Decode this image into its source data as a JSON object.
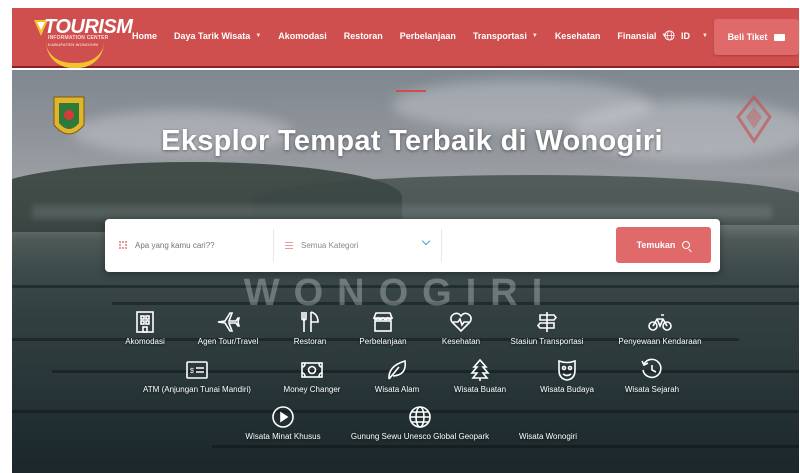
{
  "navbar": {
    "logo": {
      "title": "TOURISM",
      "subtitle": "INFORMATION CENTER",
      "tagline": "KABUPATEN WONOGIRI"
    },
    "menu": [
      {
        "label": "Home",
        "dropdown": false
      },
      {
        "label": "Daya Tarik Wisata",
        "dropdown": true
      },
      {
        "label": "Akomodasi",
        "dropdown": false
      },
      {
        "label": "Restoran",
        "dropdown": false
      },
      {
        "label": "Perbelanjaan",
        "dropdown": false
      },
      {
        "label": "Transportasi",
        "dropdown": true
      },
      {
        "label": "Kesehatan",
        "dropdown": false
      },
      {
        "label": "Finansial",
        "dropdown": true
      }
    ],
    "language": "ID",
    "ticket_button": "Beli Tiket",
    "colors": {
      "navbar": "#cf4f4f",
      "button": "#e06a6a"
    }
  },
  "hero": {
    "title": "Eksplor Tempat Terbaik di Wonogiri",
    "watermark": "WONOGIRI"
  },
  "search": {
    "placeholder": "Apa yang kamu cari??",
    "category_value": "Semua Kategori",
    "button_label": "Temukan"
  },
  "categories": {
    "row1": [
      {
        "label": "Akomodasi",
        "icon": "building-icon"
      },
      {
        "label": "Agen Tour/Travel",
        "icon": "airplane-icon"
      },
      {
        "label": "Restoran",
        "icon": "utensils-icon"
      },
      {
        "label": "Perbelanjaan",
        "icon": "store-icon"
      },
      {
        "label": "Kesehatan",
        "icon": "heart-pulse-icon"
      },
      {
        "label": "Stasiun Transportasi",
        "icon": "signpost-icon"
      },
      {
        "label": "Penyewaan Kendaraan",
        "icon": "bicycle-icon"
      }
    ],
    "row2": [
      {
        "label": "ATM (Anjungan Tunai Mandiri)",
        "icon": "atm-card-icon"
      },
      {
        "label": "Money Changer",
        "icon": "money-icon"
      },
      {
        "label": "Wisata Alam",
        "icon": "leaf-icon"
      },
      {
        "label": "Wisata Buatan",
        "icon": "tree-icon"
      },
      {
        "label": "Wisata Budaya",
        "icon": "mask-icon"
      },
      {
        "label": "Wisata Sejarah",
        "icon": "history-icon"
      }
    ],
    "row3": [
      {
        "label": "Wisata Minat Khusus",
        "icon": "play-circle-icon"
      },
      {
        "label": "Gunung Sewu Unesco Global Geopark",
        "icon": "globe-icon"
      },
      {
        "label": "Wisata Wonogiri",
        "icon": "placeholder-icon"
      }
    ]
  }
}
